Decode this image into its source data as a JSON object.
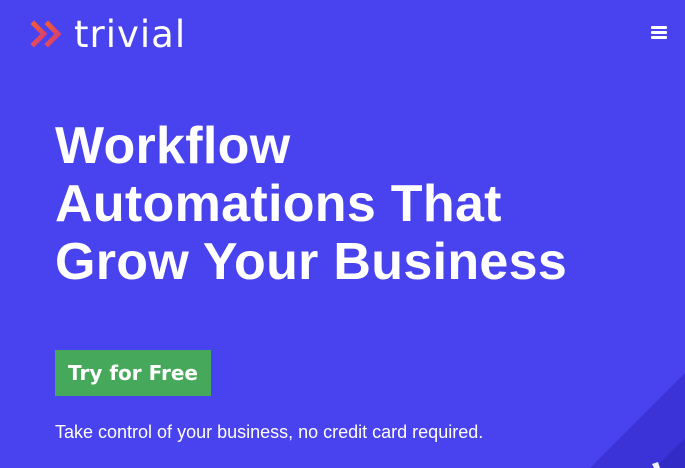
{
  "header": {
    "brand_name": "trivial",
    "logo_icon": "double-chevron-right-icon",
    "menu_icon": "hamburger-menu-icon"
  },
  "hero": {
    "headline_lines": [
      "Workflow",
      "Automations That",
      "Grow Your Business"
    ],
    "cta_label": "Try for Free",
    "subtitle": "Take control of your business, no credit card required."
  },
  "colors": {
    "background": "#4842ef",
    "cta": "#45a85a",
    "logo_gradient_start": "#f35a35",
    "logo_gradient_end": "#d43a7d",
    "text": "#ffffff"
  }
}
